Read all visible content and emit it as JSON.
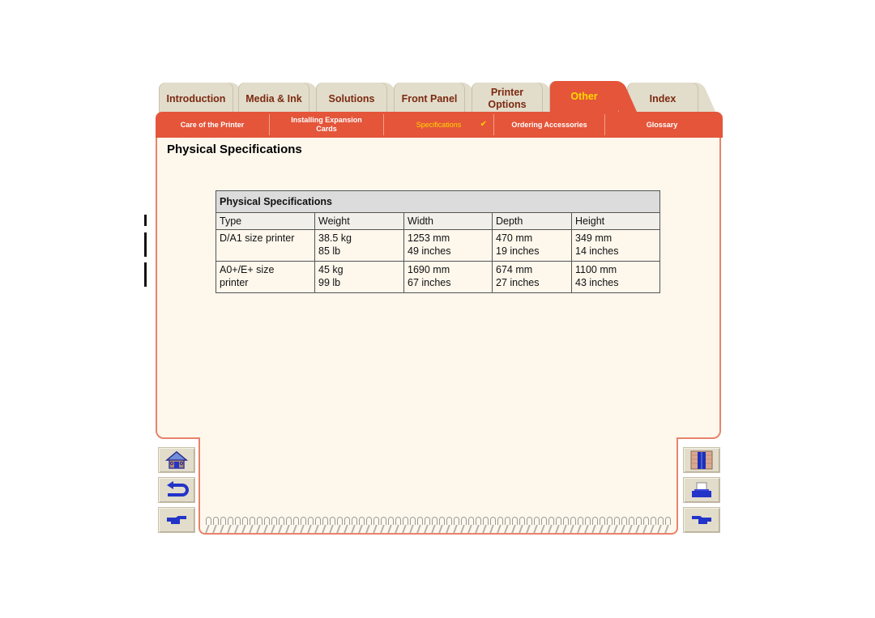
{
  "tabs": [
    {
      "label_1": "Introduction",
      "label_2": "",
      "active": false
    },
    {
      "label_1": "Media & Ink",
      "label_2": "",
      "active": false
    },
    {
      "label_1": "Solutions",
      "label_2": "",
      "active": false
    },
    {
      "label_1": "Front Panel",
      "label_2": "",
      "active": false
    },
    {
      "label_1": "Printer",
      "label_2": "Options",
      "active": false
    },
    {
      "label_1": "Other",
      "label_2": "",
      "active": true
    },
    {
      "label_1": "Index",
      "label_2": "",
      "active": false
    }
  ],
  "subnav": [
    {
      "label_1": "Care of the Printer",
      "label_2": ""
    },
    {
      "label_1": "Installing Expansion",
      "label_2": "Cards"
    },
    {
      "label_1": "Specifications",
      "label_2": "",
      "current": true,
      "check": "✔"
    },
    {
      "label_1": "Ordering Accessories",
      "label_2": ""
    },
    {
      "label_1": "Glossary",
      "label_2": ""
    }
  ],
  "page": {
    "title": "Physical Specifications"
  },
  "table": {
    "caption": "Physical Specifications",
    "headers": [
      "Type",
      "Weight",
      "Width",
      "Depth",
      "Height"
    ],
    "rows": [
      {
        "type": [
          "D/A1 size printer",
          ""
        ],
        "weight": [
          "38.5 kg",
          "85 lb"
        ],
        "width": [
          "1253 mm",
          "49 inches"
        ],
        "depth": [
          "470 mm",
          "19 inches"
        ],
        "height": [
          "349 mm",
          "14 inches"
        ]
      },
      {
        "type": [
          "A0+/E+ size",
          "printer"
        ],
        "weight": [
          "45 kg",
          "99 lb"
        ],
        "width": [
          "1690 mm",
          "67 inches"
        ],
        "depth": [
          "674 mm",
          "27 inches"
        ],
        "height": [
          "1100 mm",
          "43 inches"
        ]
      }
    ]
  },
  "nav": {
    "left": [
      "home-icon",
      "back-icon",
      "next-page-icon"
    ],
    "right": [
      "exit-icon",
      "print-icon",
      "previous-page-icon"
    ]
  },
  "colors": {
    "accent_red": "#e4553a",
    "active_tab_text": "#ffd800",
    "tab_bg": "#e2dccb",
    "tab_text": "#7b2a10",
    "page_bg": "#fdf7ec"
  }
}
